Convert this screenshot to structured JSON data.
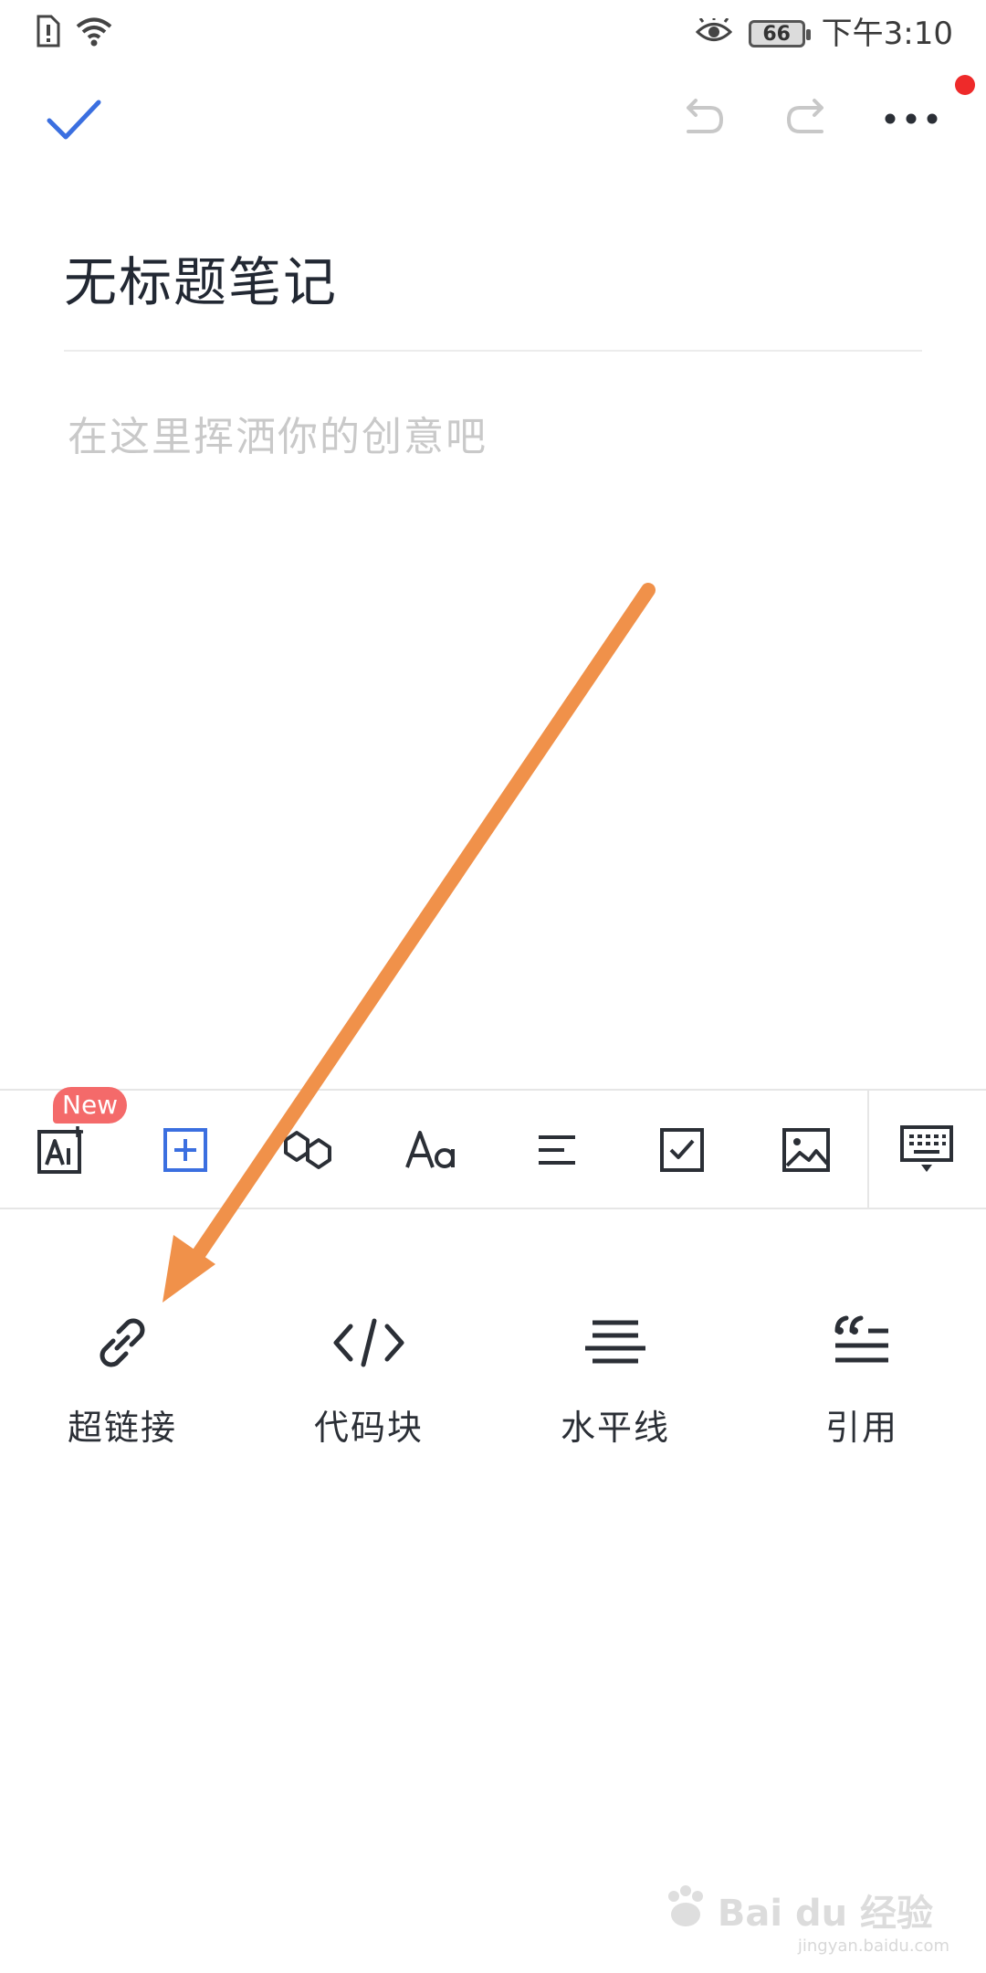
{
  "status_bar": {
    "battery_level": "66",
    "time": "下午3:10",
    "icons": [
      "sim-alert-icon",
      "wifi-icon",
      "eye-comfort-icon",
      "battery-icon"
    ]
  },
  "toolbar": {
    "icons": [
      "check-icon",
      "undo-icon",
      "redo-icon",
      "more-icon"
    ]
  },
  "note": {
    "title": "无标题笔记",
    "body_placeholder": "在这里挥洒你的创意吧"
  },
  "format_bar": {
    "new_badge": "New",
    "tools": [
      {
        "icon": "ai-icon"
      },
      {
        "icon": "insert-icon"
      },
      {
        "icon": "link-format-icon"
      },
      {
        "icon": "font-style-icon"
      },
      {
        "icon": "align-icon"
      },
      {
        "icon": "checkbox-icon"
      },
      {
        "icon": "image-icon"
      },
      {
        "icon": "keyboard-icon"
      }
    ]
  },
  "insert_panel": {
    "items": [
      {
        "label": "超链接",
        "icon": "hyperlink-icon"
      },
      {
        "label": "代码块",
        "icon": "code-block-icon"
      },
      {
        "label": "水平线",
        "icon": "horizontal-line-icon"
      },
      {
        "label": "引用",
        "icon": "quote-icon"
      }
    ]
  },
  "colors": {
    "accent": "#3b6fe0",
    "annotation_arrow": "#f0914a",
    "badge": "#f46a6a",
    "notify_dot": "#ee2a2a"
  },
  "watermark": {
    "main": "Bai du 经验",
    "sub": "jingyan.baidu.com"
  }
}
